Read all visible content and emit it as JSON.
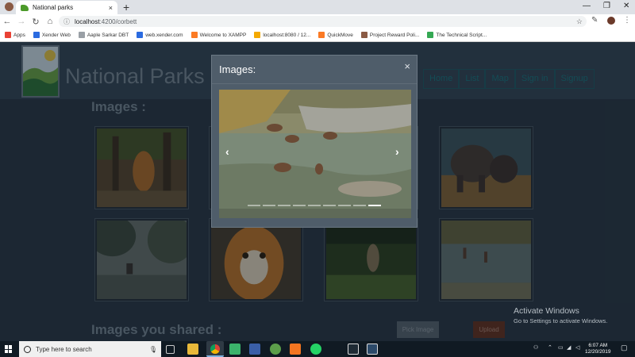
{
  "browser": {
    "tab_title": "National parks",
    "tab_close": "×",
    "new_tab": "+",
    "url_host": "localhost",
    "url_path": ":4200/corbett",
    "bookmarks": [
      {
        "label": "Apps",
        "icon": "apps-grid-icon",
        "color": "#e94235"
      },
      {
        "label": "Xender Web",
        "icon": "xender-icon",
        "color": "#2b6be0"
      },
      {
        "label": "Aaple Sarkar DBT",
        "icon": "doc-icon",
        "color": "#9aa0a6"
      },
      {
        "label": "web.xender.com",
        "icon": "xender-icon",
        "color": "#2b6be0"
      },
      {
        "label": "Welcome to XAMPP",
        "icon": "xampp-icon",
        "color": "#fb7a24"
      },
      {
        "label": "localhost:8080 / 12...",
        "icon": "phpmyadmin-icon",
        "color": "#f4a900"
      },
      {
        "label": "QuickMove",
        "icon": "quickmove-icon",
        "color": "#fb7a24"
      },
      {
        "label": "Project Reward Poli...",
        "icon": "doc-icon",
        "color": "#8a5a44"
      },
      {
        "label": "The Technical Script...",
        "icon": "technical-icon",
        "color": "#34a853"
      }
    ]
  },
  "header": {
    "title": "National Parks o",
    "nav": [
      "Home",
      "List",
      "Map",
      "Sign in",
      "Signup"
    ]
  },
  "main": {
    "images_heading": "Images :",
    "shared_heading": "Images you shared :",
    "pick_label": "Pick Image",
    "upload_label": "Upload"
  },
  "modal": {
    "title": "Images:",
    "close": "×",
    "prev": "‹",
    "next": "›",
    "slide_count": 9,
    "active_slide": 8
  },
  "watermark": {
    "line1": "Activate Windows",
    "line2": "Go to Settings to activate Windows."
  },
  "taskbar": {
    "search_placeholder": "Type here to search",
    "time": "6:07 AM",
    "date": "12/20/2019"
  },
  "colors": {
    "nav_teal": "#1b7d86",
    "header_bg": "#35495a",
    "modal_bg": "#4f5d6a"
  }
}
